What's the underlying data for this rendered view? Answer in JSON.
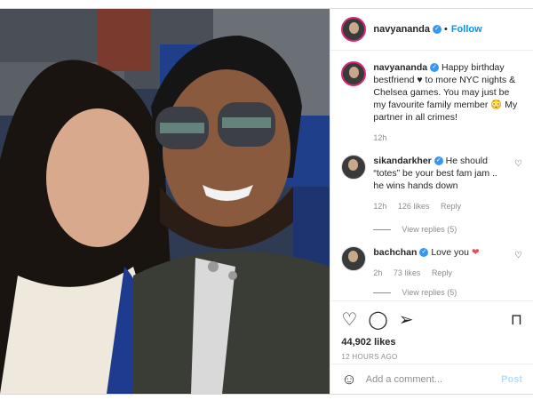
{
  "post": {
    "username": "navyananda",
    "verified_icon": "verified-badge-icon",
    "follow_label": "Follow",
    "dot": "•",
    "caption": {
      "username": "navyananda",
      "text": "Happy birthday bestfriend ♥ to more NYC nights & Chelsea games. You may just be my favourite family member 😳 My partner in all crimes!",
      "time": "12h"
    },
    "comments": [
      {
        "username": "sikandarkher",
        "text": "He should “totes” be your best fam jam .. he wins hands down",
        "time": "12h",
        "likes": "126 likes",
        "reply": "Reply",
        "view_replies": "View replies (5)"
      },
      {
        "username": "bachchan",
        "text": "Love you",
        "heart": "❤",
        "time": "2h",
        "likes": "73 likes",
        "reply": "Reply",
        "view_replies": "View replies (5)"
      }
    ],
    "likes_count": "44,902 likes",
    "time_ago": "12 HOURS AGO",
    "add_comment_placeholder": "Add a comment...",
    "post_button": "Post",
    "colors": {
      "accent": "#0095f6",
      "heart_red": "#ed4956",
      "verified": "#3897f0"
    }
  }
}
